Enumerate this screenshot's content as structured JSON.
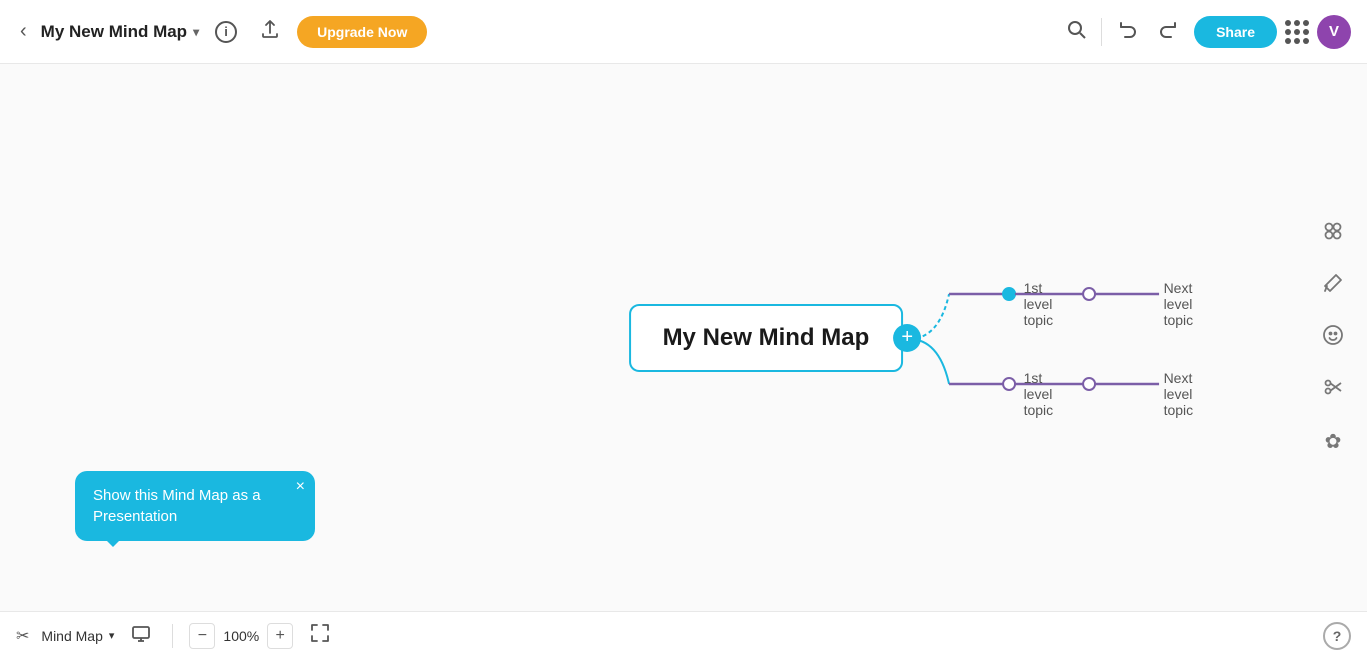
{
  "header": {
    "back_label": "‹",
    "title": "My New Mind Map",
    "chevron": "∨",
    "info_icon": "ℹ",
    "upload_icon": "⬆",
    "upgrade_label": "Upgrade Now",
    "search_icon": "🔍",
    "undo_icon": "↩",
    "redo_icon": "↪",
    "share_label": "Share",
    "grid_dots": 9,
    "avatar_label": "V"
  },
  "canvas": {
    "center_node_text": "My New Mind Map",
    "add_icon": "+",
    "branches": [
      {
        "id": "top",
        "level1_label": "1st level topic",
        "next_label": "Next level topic",
        "dot_color": "filled"
      },
      {
        "id": "bottom",
        "level1_label": "1st level topic",
        "next_label": "Next level topic",
        "dot_color": "empty"
      }
    ]
  },
  "tooltip": {
    "text": "Show this Mind Map as a Presentation",
    "close_icon": "×"
  },
  "bottom_toolbar": {
    "scissors_icon": "✂",
    "mode_label": "Mind Map",
    "mode_chevron": "∨",
    "presentation_icon": "▶",
    "zoom_out": "−",
    "zoom_level": "100%",
    "zoom_in": "+",
    "fullscreen_icon": "⤢",
    "help_icon": "?"
  },
  "right_toolbar": {
    "icons": [
      "⠿",
      "✎",
      "☺",
      "✂",
      "❋"
    ]
  },
  "colors": {
    "accent": "#1ab8e0",
    "purple": "#7b5ea7",
    "upgrade": "#f5a623",
    "avatar_bg": "#8e44ad"
  }
}
